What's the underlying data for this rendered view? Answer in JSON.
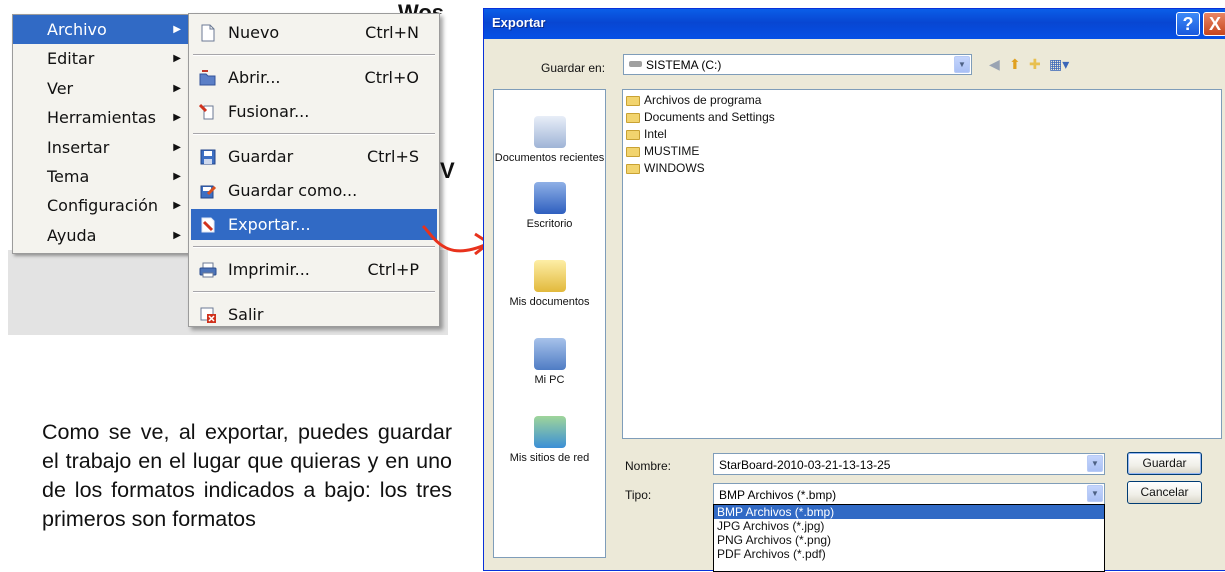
{
  "background_text": [
    "Wos",
    "V"
  ],
  "main_menu": [
    {
      "label": "Archivo",
      "selected": true
    },
    {
      "label": "Editar"
    },
    {
      "label": "Ver"
    },
    {
      "label": "Herramientas"
    },
    {
      "label": "Insertar"
    },
    {
      "label": "Tema"
    },
    {
      "label": "Configuración"
    },
    {
      "label": "Ayuda"
    }
  ],
  "submenu": {
    "nuevo": {
      "label": "Nuevo",
      "shortcut": "Ctrl+N"
    },
    "abrir": {
      "label": "Abrir...",
      "shortcut": "Ctrl+O"
    },
    "fusionar": {
      "label": "Fusionar..."
    },
    "guardar": {
      "label": "Guardar",
      "shortcut": "Ctrl+S"
    },
    "guardar_como": {
      "label": "Guardar como..."
    },
    "exportar": {
      "label": "Exportar...",
      "selected": true
    },
    "imprimir": {
      "label": "Imprimir...",
      "shortcut": "Ctrl+P"
    },
    "salir": {
      "label": "Salir"
    }
  },
  "caption": "Como se ve, al exportar, puedes guardar el trabajo en el lugar que quieras y en uno de los formatos indicados a bajo: los tres primeros son formatos",
  "dialog": {
    "title": "Exportar",
    "help_glyph": "?",
    "close_glyph": "X",
    "look_in_label": "Guardar en:",
    "look_in_value": "SISTEMA (C:)",
    "places": [
      {
        "label": "Documentos recientes",
        "icon": "recent-documents-icon"
      },
      {
        "label": "Escritorio",
        "icon": "desktop-icon"
      },
      {
        "label": "Mis documentos",
        "icon": "my-documents-icon"
      },
      {
        "label": "Mi PC",
        "icon": "my-computer-icon"
      },
      {
        "label": "Mis sitios de red",
        "icon": "network-places-icon"
      }
    ],
    "folders": [
      "Archivos de programa",
      "Documents and Settings",
      "Intel",
      "MUSTIME",
      "WINDOWS"
    ],
    "filename_label": "Nombre:",
    "filename_value": "StarBoard-2010-03-21-13-13-25",
    "type_label": "Tipo:",
    "type_value": "BMP Archivos (*.bmp)",
    "save_button": "Guardar",
    "cancel_button": "Cancelar",
    "type_options": [
      "BMP Archivos (*.bmp)",
      "JPG Archivos (*.jpg)",
      "PNG Archivos (*.png)",
      "PDF Archivos (*.pdf)"
    ]
  },
  "colors": {
    "selection": "#316ac5",
    "titlebar": "#0846d2",
    "arrow": "#e8321c"
  }
}
